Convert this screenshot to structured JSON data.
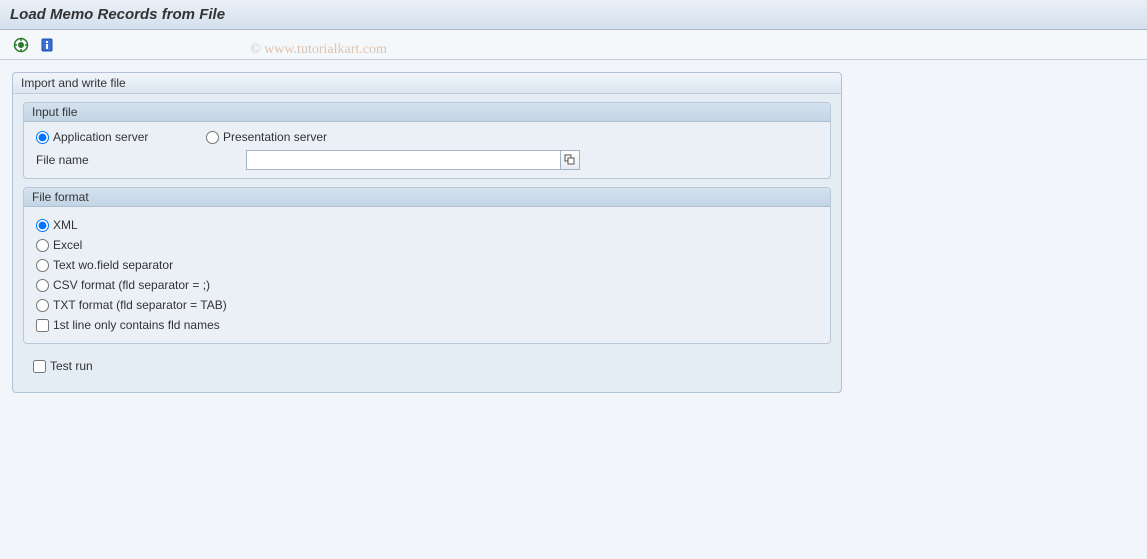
{
  "header": {
    "title": "Load Memo Records from File"
  },
  "watermark": "© www.tutorialkart.com",
  "panel": {
    "title": "Import and write file"
  },
  "input_file": {
    "title": "Input file",
    "options": {
      "app_server": "Application server",
      "pres_server": "Presentation server"
    },
    "file_name_label": "File name",
    "file_name_value": ""
  },
  "file_format": {
    "title": "File format",
    "options": {
      "xml": "XML",
      "excel": "Excel",
      "text_wo": "Text wo.field separator",
      "csv": "CSV format (fld separator = ;)",
      "txt_tab": "TXT format (fld separator = TAB)"
    },
    "first_line_names": "1st line only contains fld names"
  },
  "test_run_label": "Test run"
}
